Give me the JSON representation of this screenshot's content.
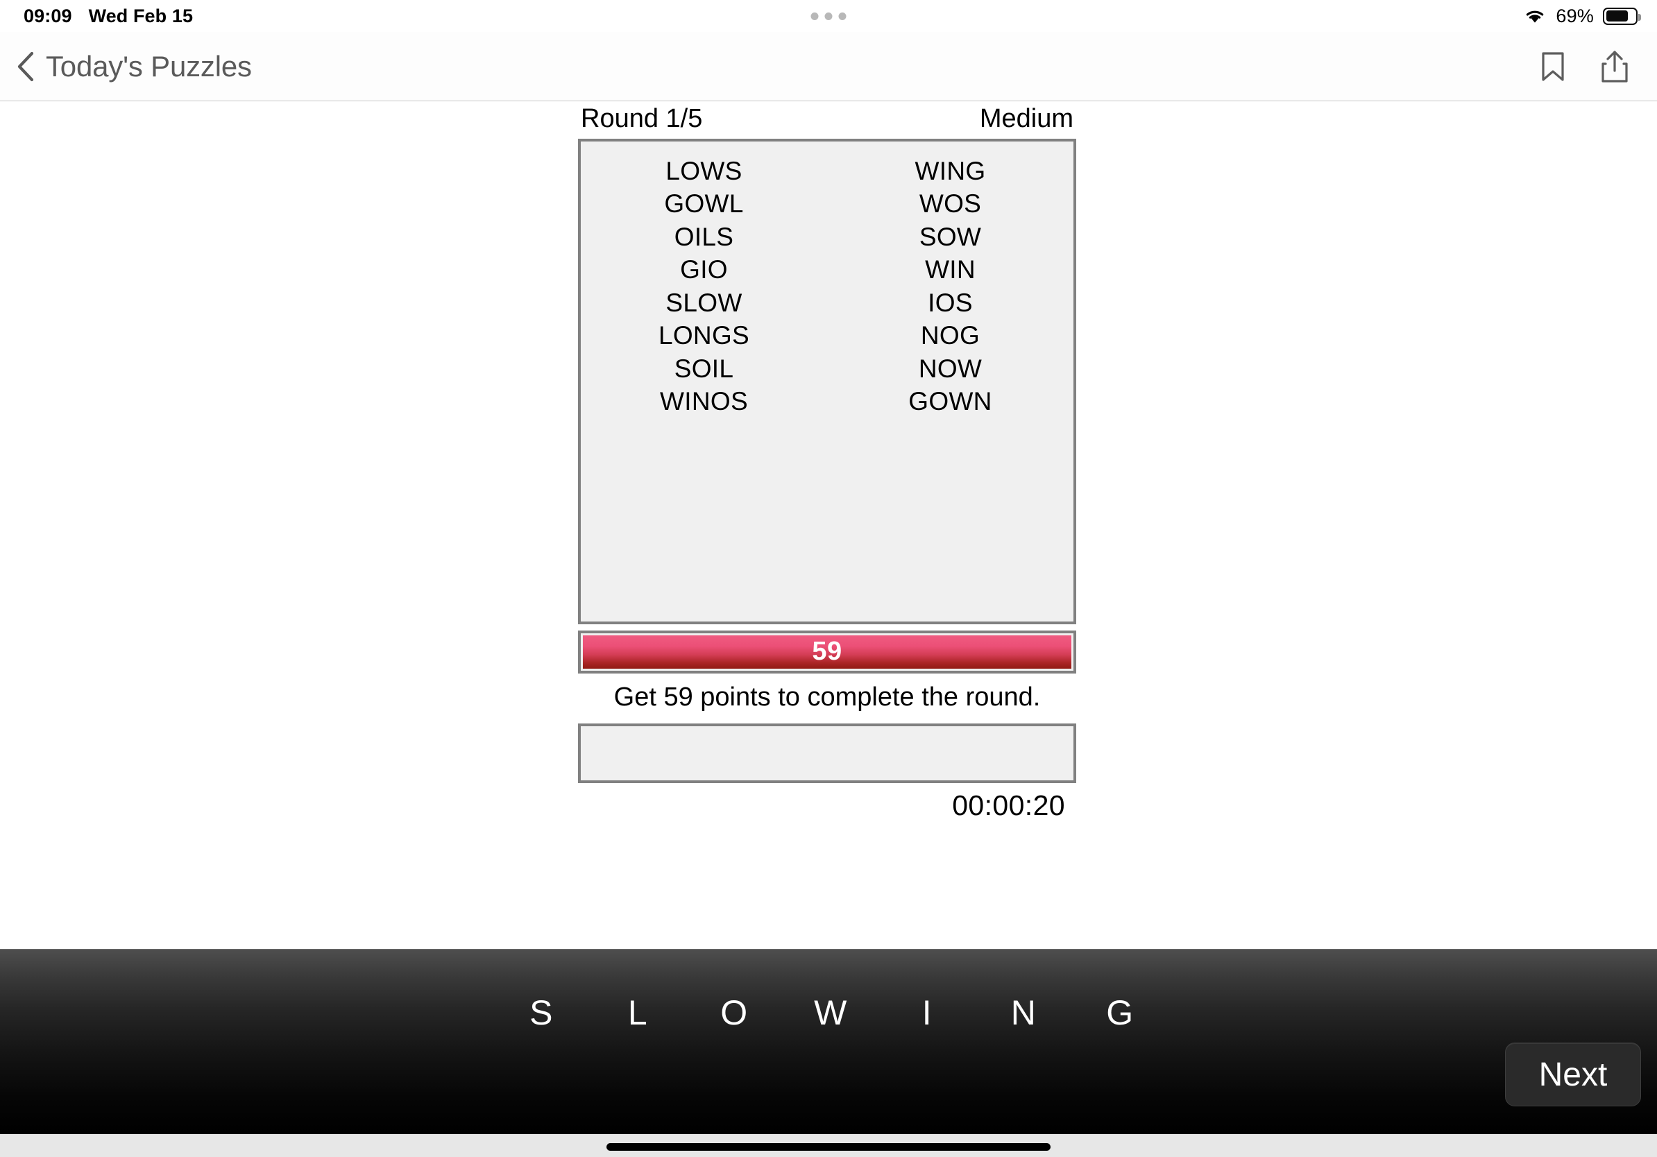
{
  "status_bar": {
    "time": "09:09",
    "date": "Wed Feb 15",
    "battery_percent": "69%",
    "wifi_icon": "wifi-icon",
    "battery_icon": "battery-icon",
    "battery_fill_ratio": 0.68,
    "multitask_dots_icon": "multitask-dots-icon"
  },
  "nav_bar": {
    "back_icon": "chevron-left-icon",
    "title": "Today's Puzzles",
    "bookmark_icon": "bookmark-icon",
    "share_icon": "share-icon"
  },
  "game": {
    "round_label": "Round 1/5",
    "difficulty_label": "Medium",
    "found_words_left": [
      "LOWS",
      "GOWL",
      "OILS",
      "GIO",
      "SLOW",
      "LONGS",
      "SOIL",
      "WINOS"
    ],
    "found_words_right": [
      "WING",
      "WOS",
      "SOW",
      "WIN",
      "IOS",
      "NOG",
      "NOW",
      "GOWN"
    ],
    "score_value": "59",
    "goal_text": "Get 59 points to complete the round.",
    "answer_value": "",
    "answer_placeholder": "",
    "timer": "00:00:20",
    "letters": [
      "S",
      "L",
      "O",
      "W",
      "I",
      "N",
      "G"
    ],
    "next_label": "Next",
    "colors": {
      "progress_top": "#ef5b81",
      "progress_bottom": "#901a14",
      "box_border": "#808080",
      "box_fill": "#f0f0f0",
      "tray_top": "#4e4e4e",
      "tray_bottom": "#000000"
    }
  }
}
